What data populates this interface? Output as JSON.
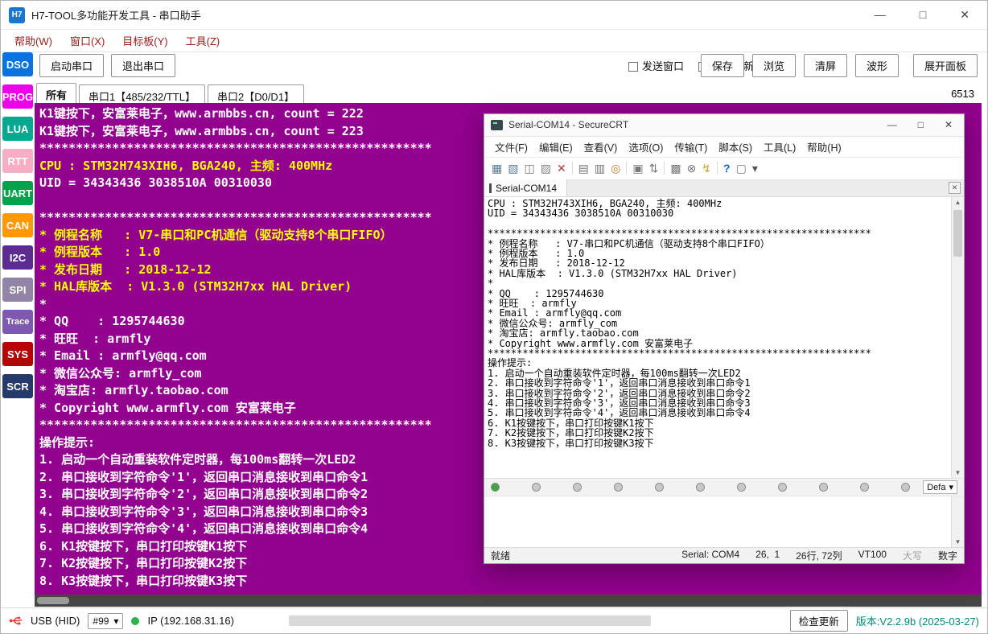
{
  "colors": {
    "terminal_bg": "#92028E",
    "terminal_yellow": "#FFFF00",
    "terminal_white": "#FFFFFF",
    "version_text": "#00897B",
    "status_green": "#2BB24C",
    "usb_red": "#E53935"
  },
  "glyphs": {
    "dropdown_arrow": "▾",
    "scroll_up": "▲",
    "scroll_down": "▼",
    "close": "✕",
    "minimize": "—",
    "maximize": "□"
  },
  "app": {
    "icon": "H7",
    "title": "H7-TOOL多功能开发工具 - 串口助手",
    "menus": [
      "帮助(W)",
      "窗口(X)",
      "目标板(Y)",
      "工具(Z)"
    ]
  },
  "sidebar": [
    {
      "label": "DSO",
      "color": "#0673E1"
    },
    {
      "label": "PROG",
      "color": "#EC00EC"
    },
    {
      "label": "LUA",
      "color": "#00A98F"
    },
    {
      "label": "RTT",
      "color": "#F6AEC4"
    },
    {
      "label": "UART",
      "color": "#00A24B"
    },
    {
      "label": "CAN",
      "color": "#FF9900"
    },
    {
      "label": "I2C",
      "color": "#5B2D8E"
    },
    {
      "label": "SPI",
      "color": "#9184A4"
    },
    {
      "label": "Trace",
      "color": "#7D59B0"
    },
    {
      "label": "SYS",
      "color": "#B40404"
    },
    {
      "label": "SCR",
      "color": "#26396B"
    }
  ],
  "toolbar": {
    "start": "启动串口",
    "exit": "退出串口",
    "send_window": "发送窗口",
    "pause_refresh": "暂停刷新",
    "save": "保存",
    "browse": "浏览",
    "clear": "清屏",
    "wave": "波形",
    "expand": "展开面板",
    "counter": "6513"
  },
  "tabs": [
    {
      "label": "所有"
    },
    {
      "label": "串口1【485/232/TTL】"
    },
    {
      "label": "串口2【D0/D1】"
    }
  ],
  "terminal": {
    "lines": [
      {
        "t": "K1键按下，安富莱电子，www.armbbs.cn, count = 222"
      },
      {
        "t": "K1键按下，安富莱电子，www.armbbs.cn, count = 223"
      },
      {
        "t": "******************************************************"
      },
      {
        "t": "CPU : STM32H743XIH6, BGA240, 主频: 400MHz",
        "c": "#FFFF00"
      },
      {
        "t": "UID = 34343436 3038510A 00310030"
      },
      {
        "t": ""
      },
      {
        "t": "******************************************************"
      },
      {
        "t": "* 例程名称   : V7-串口和PC机通信（驱动支持8个串口FIFO）",
        "c": "#FFFF00"
      },
      {
        "t": "* 例程版本   : 1.0",
        "c": "#FFFF00"
      },
      {
        "t": "* 发布日期   : 2018-12-12",
        "c": "#FFFF00"
      },
      {
        "t": "* HAL库版本  : V1.3.0 (STM32H7xx HAL Driver)",
        "c": "#FFFF00"
      },
      {
        "t": "*"
      },
      {
        "t": "* QQ    : 1295744630"
      },
      {
        "t": "* 旺旺  : armfly"
      },
      {
        "t": "* Email : armfly@qq.com"
      },
      {
        "t": "* 微信公众号: armfly_com"
      },
      {
        "t": "* 淘宝店: armfly.taobao.com"
      },
      {
        "t": "* Copyright www.armfly.com 安富莱电子"
      },
      {
        "t": "******************************************************"
      },
      {
        "t": "操作提示:"
      },
      {
        "t": "1. 启动一个自动重装软件定时器，每100ms翻转一次LED2"
      },
      {
        "t": "2. 串口接收到字符命令'1'，返回串口消息接收到串口命令1"
      },
      {
        "t": "3. 串口接收到字符命令'2'，返回串口消息接收到串口命令2"
      },
      {
        "t": "4. 串口接收到字符命令'3'，返回串口消息接收到串口命令3"
      },
      {
        "t": "5. 串口接收到字符命令'4'，返回串口消息接收到串口命令4"
      },
      {
        "t": "6. K1按键按下，串口打印按键K1按下"
      },
      {
        "t": "7. K2按键按下，串口打印按键K2按下"
      },
      {
        "t": "8. K3按键按下，串口打印按键K3按下"
      }
    ]
  },
  "statusbar": {
    "usb": "USB (HID)",
    "channel": "#99",
    "ip": "IP (192.168.31.16)",
    "check_update": "检查更新",
    "version": "版本:V2.2.9b (2025-03-27)"
  },
  "securecrt": {
    "title": "Serial-COM14 - SecureCRT",
    "menus": [
      "文件(F)",
      "编辑(E)",
      "查看(V)",
      "选项(O)",
      "传输(T)",
      "脚本(S)",
      "工具(L)",
      "帮助(H)"
    ],
    "toolbar_icons": [
      {
        "name": "connect-icon",
        "glyph": "▦",
        "color": "#5b7c99"
      },
      {
        "name": "quick-connect-icon",
        "glyph": "▧",
        "color": "#5b7c99"
      },
      {
        "name": "clone-session-icon",
        "glyph": "◫",
        "color": "#777777"
      },
      {
        "name": "reconnect-icon",
        "glyph": "▨",
        "color": "#888888"
      },
      {
        "name": "disconnect-icon",
        "glyph": "✕",
        "color": "#b23b3b"
      },
      {
        "name": "separator"
      },
      {
        "name": "copy-icon",
        "glyph": "▤",
        "color": "#777777"
      },
      {
        "name": "paste-icon",
        "glyph": "▥",
        "color": "#777777"
      },
      {
        "name": "find-icon",
        "glyph": "◎",
        "color": "#c77b2f"
      },
      {
        "name": "separator"
      },
      {
        "name": "print-icon",
        "glyph": "▣",
        "color": "#777777"
      },
      {
        "name": "transfer-icon",
        "glyph": "⇅",
        "color": "#777777"
      },
      {
        "name": "separator"
      },
      {
        "name": "properties-icon",
        "glyph": "▩",
        "color": "#777777"
      },
      {
        "name": "options-icon",
        "glyph": "⊗",
        "color": "#777777"
      },
      {
        "name": "lightning-icon",
        "glyph": "↯",
        "color": "#c9a227"
      },
      {
        "name": "separator"
      },
      {
        "name": "help-icon",
        "glyph": "?",
        "color": "#1a66cc"
      },
      {
        "name": "grid-icon",
        "glyph": "▢",
        "color": "#777777"
      },
      {
        "name": "overflow-chevron-icon",
        "glyph": "▾",
        "color": "#555555"
      }
    ],
    "tab": "Serial-COM14",
    "terminal_lines": [
      {
        "t": "CPU : STM32H743XIH6, BGA240, 主频: 400MHz"
      },
      {
        "t": "UID = 34343436 3038510A 00310030"
      },
      {
        "t": ""
      },
      {
        "t": "******************************************************************"
      },
      {
        "t": "* 例程名称   : V7-串口和PC机通信（驱动支持8个串口FIFO）"
      },
      {
        "t": "* 例程版本   : 1.0"
      },
      {
        "t": "* 发布日期   : 2018-12-12"
      },
      {
        "t": "* HAL库版本  : V1.3.0 (STM32H7xx HAL Driver)"
      },
      {
        "t": "*"
      },
      {
        "t": "* QQ    : 1295744630"
      },
      {
        "t": "* 旺旺  : armfly"
      },
      {
        "t": "* Email : armfly@qq.com"
      },
      {
        "t": "* 微信公众号: armfly_com"
      },
      {
        "t": "* 淘宝店: armfly.taobao.com"
      },
      {
        "t": "* Copyright www.armfly.com 安富莱电子"
      },
      {
        "t": "******************************************************************"
      },
      {
        "t": "操作提示:"
      },
      {
        "t": "1. 启动一个自动重装软件定时器，每100ms翻转一次LED2"
      },
      {
        "t": "2. 串口接收到字符命令'1'，返回串口消息接收到串口命令1"
      },
      {
        "t": "3. 串口接收到字符命令'2'，返回串口消息接收到串口命令2"
      },
      {
        "t": "4. 串口接收到字符命令'3'，返回串口消息接收到串口命令3"
      },
      {
        "t": "5. 串口接收到字符命令'4'，返回串口消息接收到串口命令4"
      },
      {
        "t": "6. K1按键按下，串口打印按键K1按下"
      },
      {
        "t": "7. K2按键按下，串口打印按键K2按下"
      },
      {
        "t": "8. K3按键按下，串口打印按键K3按下"
      }
    ],
    "session_indicators": [
      "#3fa53f",
      "#c9c9c9",
      "#c9c9c9",
      "#c9c9c9",
      "#c9c9c9",
      "#c9c9c9",
      "#c9c9c9",
      "#c9c9c9",
      "#c9c9c9",
      "#c9c9c9",
      "#c9c9c9"
    ],
    "session_dropdown": "Defa",
    "status": {
      "ready": "就绪",
      "serial": "Serial: COM4",
      "cursor": "26,  1",
      "size": "26行, 72列",
      "emulation": "VT100",
      "caps": "大写",
      "num": "数字"
    }
  }
}
